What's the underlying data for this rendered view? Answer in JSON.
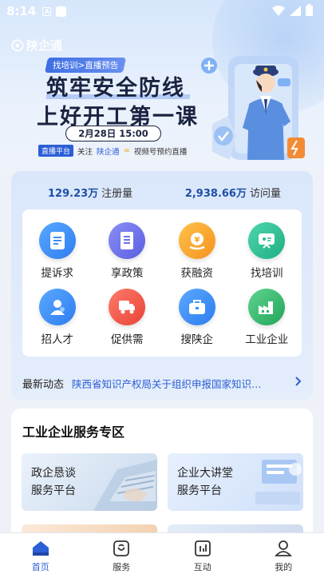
{
  "status_bar": {
    "time": "8:14",
    "a_icon": "A"
  },
  "banner": {
    "logo_text": "陕企通",
    "tag": "找培训>直播预告",
    "title_line1": "筑牢安全防线",
    "title_line2": "上好开工第一课",
    "date": "2月28日 15:00",
    "live_badge": "直播平台",
    "footer_prefix": "关注",
    "footer_highlight": "陕企通",
    "footer_suffix": "视频号预约直播"
  },
  "stats": {
    "registered_value": "129.23万",
    "registered_label": "注册量",
    "visits_value": "2,938.66万",
    "visits_label": "访问量"
  },
  "services": [
    {
      "label": "提诉求",
      "icon": "document-icon",
      "color": "#3a8df5"
    },
    {
      "label": "享政策",
      "icon": "policy-icon",
      "color": "#6a72e8"
    },
    {
      "label": "获融资",
      "icon": "finance-icon",
      "color": "#f5a623"
    },
    {
      "label": "找培训",
      "icon": "training-icon",
      "color": "#2dbc94"
    },
    {
      "label": "招人才",
      "icon": "talent-icon",
      "color": "#3a8df5"
    },
    {
      "label": "促供需",
      "icon": "truck-icon",
      "color": "#f05a4f"
    },
    {
      "label": "搜陕企",
      "icon": "briefcase-icon",
      "color": "#3a8df5"
    },
    {
      "label": "工业企业",
      "icon": "factory-icon",
      "color": "#2fb56b"
    }
  ],
  "news": {
    "title": "最新动态",
    "text": "陕西省知识产权局关于组织申报国家知识…"
  },
  "industrial": {
    "title": "工业企业服务专区",
    "cards": [
      {
        "line1": "政企恳谈",
        "line2": "服务平台"
      },
      {
        "line1": "企业大讲堂",
        "line2": "服务平台"
      }
    ]
  },
  "nav": [
    {
      "label": "首页",
      "icon": "home-icon",
      "active": true
    },
    {
      "label": "服务",
      "icon": "service-icon",
      "active": false
    },
    {
      "label": "互动",
      "icon": "interaction-icon",
      "active": false
    },
    {
      "label": "我的",
      "icon": "profile-icon",
      "active": false
    }
  ],
  "colors": {
    "primary": "#2c5fd6",
    "stat_number": "#1d4fa6"
  }
}
